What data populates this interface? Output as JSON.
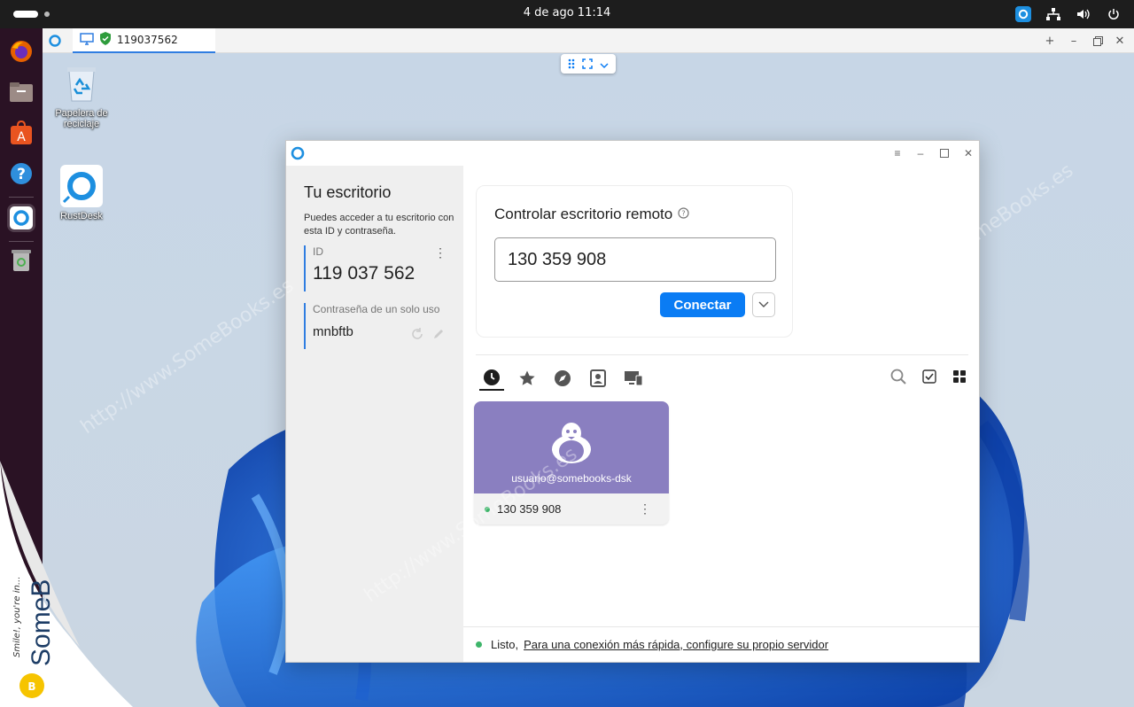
{
  "topbar": {
    "clock": "4 de ago  11:14"
  },
  "viewer": {
    "tab_title": "119037562"
  },
  "desktop": {
    "icons": [
      {
        "label_line1": "Papelera de",
        "label_line2": "reciclaje"
      },
      {
        "label_line1": "RustDesk",
        "label_line2": ""
      }
    ]
  },
  "rustdesk": {
    "left": {
      "title": "Tu escritorio",
      "description": "Puedes acceder a tu escritorio con esta ID y contraseña.",
      "id_label": "ID",
      "id_value": "119 037 562",
      "password_label": "Contraseña de un solo uso",
      "password_value": "mnbftb"
    },
    "control": {
      "title": "Controlar escritorio remoto",
      "id_input_value": "130 359 908",
      "connect_label": "Conectar"
    },
    "peer": {
      "username": "usuario@somebooks-dsk",
      "id": "130 359 908"
    },
    "status": {
      "state": "Listo,",
      "link": "Para una conexión más rápida, configure su propio servidor"
    }
  },
  "watermark": {
    "text": "http://www.SomeBooks.es",
    "corner_brand": "SomeB",
    "corner_tagline": "Smile!, you're in..."
  },
  "colors": {
    "accent": "#0a7cf4",
    "peer_card": "#8a7fc0",
    "online": "#3eb56a",
    "dock": "#2a1224"
  }
}
